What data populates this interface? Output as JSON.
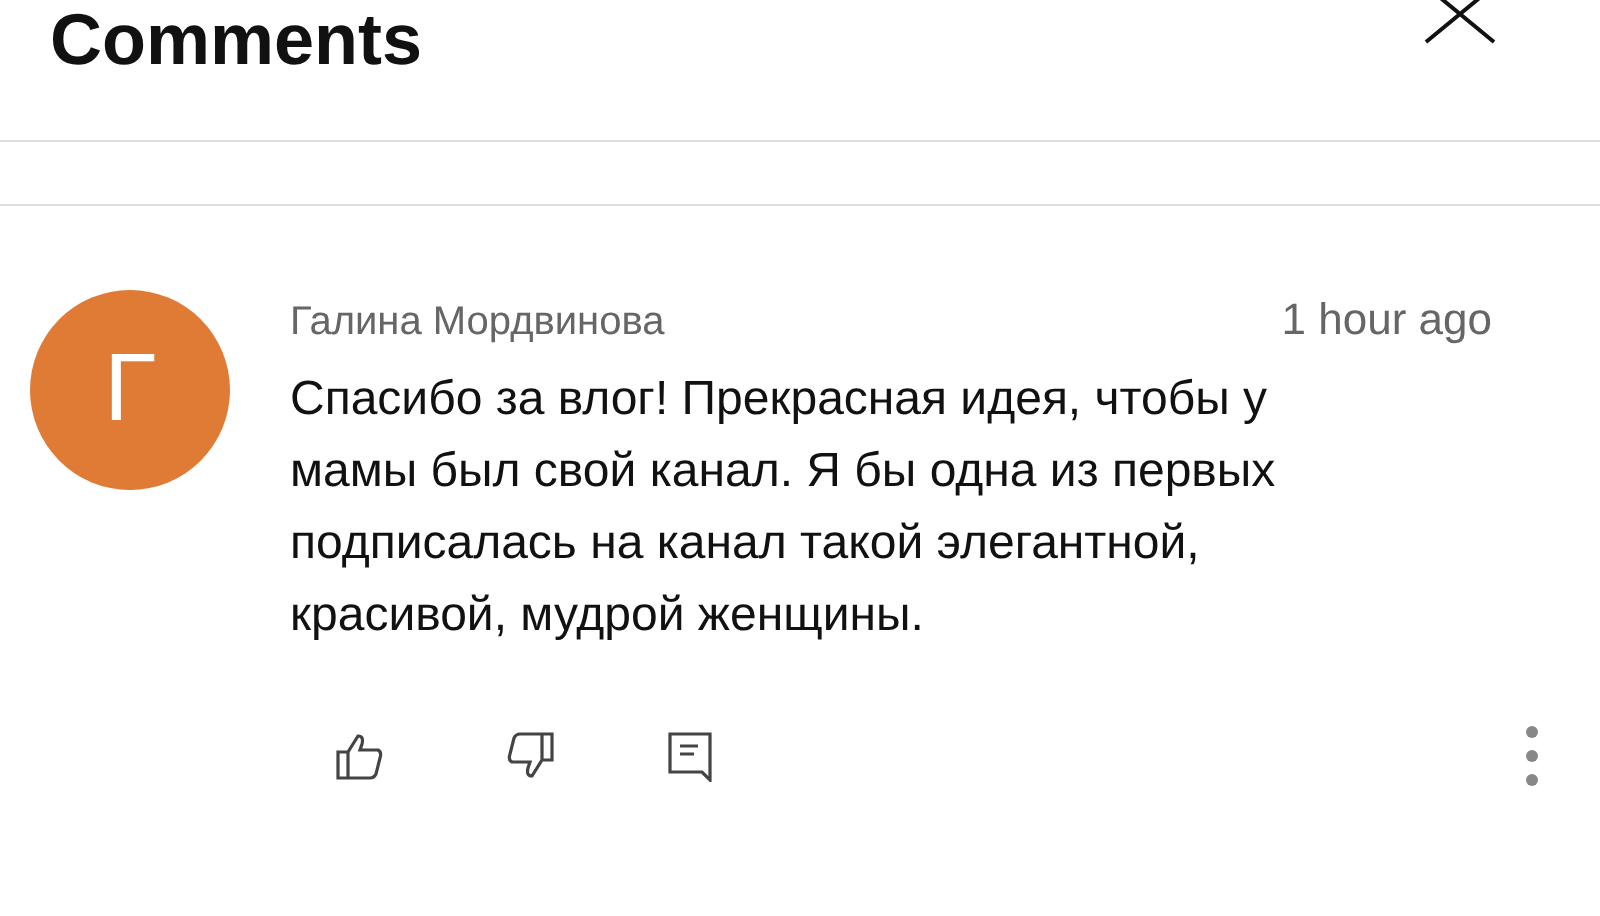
{
  "header": {
    "title": "Comments"
  },
  "comments": [
    {
      "avatar_letter": "Г",
      "author": "Галина Мордвинова",
      "time": "1 hour ago",
      "text": "Спасибо за влог! Прекрасная идея, чтобы у мамы был свой канал. Я бы одна из первых подписалась на канал такой элегантной, красивой, мудрой женщины."
    }
  ]
}
